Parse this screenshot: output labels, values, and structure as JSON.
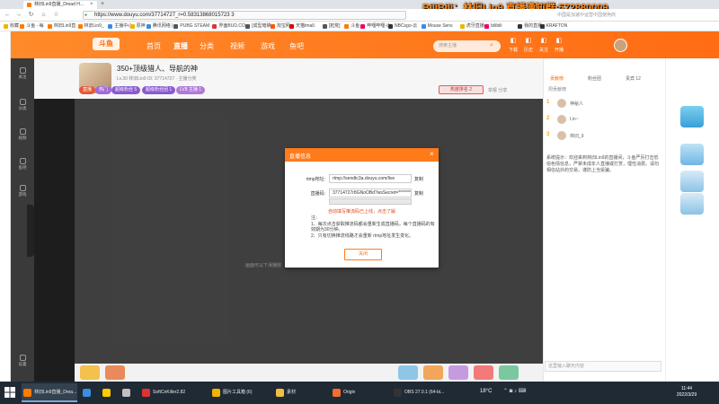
{
  "browser": {
    "tab_title": "林旧Lin9直播_Dread H…",
    "url": "https://www.douyu.com/37714727_r=0.58313868015723 3",
    "hint": "中国是加速中运营中国使用商",
    "overlay_banner": "BiliBili：林旧Lin9 直播通知群:572880009",
    "bookmarks": [
      {
        "label": "收藏",
        "color": "#f0b400"
      },
      {
        "label": "斗鱼 - 每",
        "color": "#ff7a00"
      },
      {
        "label": "林旧Lin9直",
        "color": "#ff7a00"
      },
      {
        "label": "林旧Lin9_",
        "color": "#ff7a00"
      },
      {
        "label": "主播中心",
        "color": "#3a8de0"
      },
      {
        "label": "原神",
        "color": "#f0b400"
      },
      {
        "label": "腾讯网络 |",
        "color": "#3a8de0"
      },
      {
        "label": "PUBG STEAM",
        "color": "#555"
      },
      {
        "label": "界面BUD.CO",
        "color": "#d33"
      },
      {
        "label": "[成型暗礁",
        "color": "#555"
      },
      {
        "label": "淘宝网",
        "color": "#ff5500"
      },
      {
        "label": "天猫tmall.",
        "color": "#d00"
      },
      {
        "label": "[拓荒]",
        "color": "#555"
      },
      {
        "label": "斗鱼",
        "color": "#ff7a00"
      },
      {
        "label": "哔哩哔哩-出",
        "color": "#e06"
      },
      {
        "label": "NBCsgo-云",
        "color": "#333"
      },
      {
        "label": "Mouse Sens",
        "color": "#3a8de0"
      },
      {
        "label": "虎牙直播-",
        "color": "#f0b400"
      },
      {
        "label": "bilibili",
        "color": "#e06"
      },
      {
        "label": "我的直播",
        "color": "#333"
      },
      {
        "label": "KRAFTON",
        "color": "#333"
      }
    ]
  },
  "site": {
    "logo": "斗鱼",
    "nav": [
      "首页",
      "直播",
      "分类",
      "视频",
      "游戏",
      "鱼吧"
    ],
    "search_placeholder": "搜索主播",
    "header_icons": [
      "下载",
      "历史",
      "关注",
      "开播"
    ]
  },
  "sidebar": {
    "items": [
      "关注",
      "分类",
      "视频",
      "鱼吧",
      "游戏",
      "设置"
    ]
  },
  "room": {
    "title": "350+顶级猎人、导航的神",
    "subtitle": "Lv.30  林旧Lin9  ID: 37714727  ·  主播分类",
    "tags": [
      {
        "label": "直播",
        "color": "#e25a3a"
      },
      {
        "label": "热门",
        "color": "#a06ad8"
      },
      {
        "label": "超级粉丝 5",
        "color": "#8a5ad0"
      },
      {
        "label": "超级粉丝团 1",
        "color": "#8a5ad0"
      },
      {
        "label": "LV8 主播 1",
        "color": "#b07ad8"
      }
    ],
    "live_badge": "热度排名 2",
    "report": "举报  分享"
  },
  "video": {
    "hint": "画面可以下滑播放"
  },
  "right_panel": {
    "tabs": [
      "贡献榜",
      "粉丝团",
      "贵宾 12"
    ],
    "rank_title": "周贡献榜",
    "ranks": [
      {
        "num": "1",
        "name": "神秘人"
      },
      {
        "num": "2",
        "name": "Lin~"
      },
      {
        "num": "3",
        "name": "林旧_9"
      }
    ],
    "notice": "系统提示：欢迎来到林旧Lin9的直播间，斗鱼严厉打击低俗色情信息，严禁未成年人直播或打赏，理性消费。请勿相信站外的交易，谨防上当受骗。",
    "chat_placeholder": "这里输入聊天内容"
  },
  "modal": {
    "title": "直播信息",
    "rtmp_label": "rtmp地址:",
    "rtmp_value": "rtmp://sendtc3a.douyu.com/live",
    "code_label": "直播码:",
    "code_value": "37714727r8GNoOBd?wsSecret=********",
    "copy": "复制",
    "error": "自动填写推流码已上线，点击了解",
    "notes_title": "注：",
    "notes": [
      "1、每次点击获取推流码都会重新生成直播码，每个直播码的有效期为30分钟。",
      "2、只有切换推流线路才会重新 rtmp地址发生变化。"
    ],
    "close_button": "关闭"
  },
  "taskbar": {
    "items": [
      {
        "label": "林旧Lin9直播_Drea...",
        "color": "#ff7a00",
        "active": true
      },
      {
        "label": "",
        "color": "#3a8de0",
        "active": false
      },
      {
        "label": "",
        "color": "#ffcc00",
        "active": false
      },
      {
        "label": "",
        "color": "#c0c0c0",
        "active": false
      },
      {
        "label": "SoftCnKiller2.82",
        "color": "#d33",
        "active": false
      },
      {
        "label": "图片工具箱 (6)",
        "color": "#f0b400",
        "active": false
      },
      {
        "label": "素材",
        "color": "#f0c040",
        "active": false
      },
      {
        "label": "Origin",
        "color": "#f56c2d",
        "active": false
      },
      {
        "label": "OBS 27.0.1 (64-bi...",
        "color": "#333",
        "active": false
      }
    ],
    "weather": "18°C",
    "time": "11:44",
    "date": "2022/3/29"
  }
}
